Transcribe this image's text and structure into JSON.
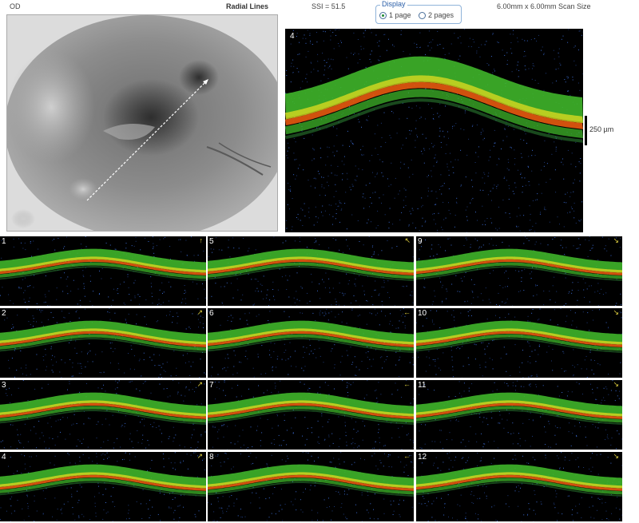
{
  "header": {
    "left_label": "OD",
    "scan_type": "Radial Lines",
    "ssi": "SSI = 51.5",
    "display_legend": "Display",
    "display_options": [
      "1 page",
      "2 pages"
    ],
    "display_selected": 0,
    "scan_size": "6.00mm x 6.00mm Scan Size"
  },
  "fundus": {
    "scan_line_color": "#ffffff"
  },
  "main_scan": {
    "label": "4",
    "scale_label": "250 µm"
  },
  "thumbnails": [
    {
      "label": "1",
      "arrow": "↑"
    },
    {
      "label": "2",
      "arrow": "↗"
    },
    {
      "label": "3",
      "arrow": "↗"
    },
    {
      "label": "4",
      "arrow": "↗"
    },
    {
      "label": "5",
      "arrow": "↖"
    },
    {
      "label": "6",
      "arrow": "←"
    },
    {
      "label": "7",
      "arrow": "←"
    },
    {
      "label": "8",
      "arrow": "←"
    },
    {
      "label": "9",
      "arrow": "↘"
    },
    {
      "label": "10",
      "arrow": "↘"
    },
    {
      "label": "11",
      "arrow": "↘"
    },
    {
      "label": "12",
      "arrow": "↘"
    }
  ],
  "colors": {
    "retina_green": "#3fb52a",
    "retina_yellow": "#d8d820",
    "rpe_orange": "#e85a10",
    "noise_blue": "#2a4a9a"
  }
}
